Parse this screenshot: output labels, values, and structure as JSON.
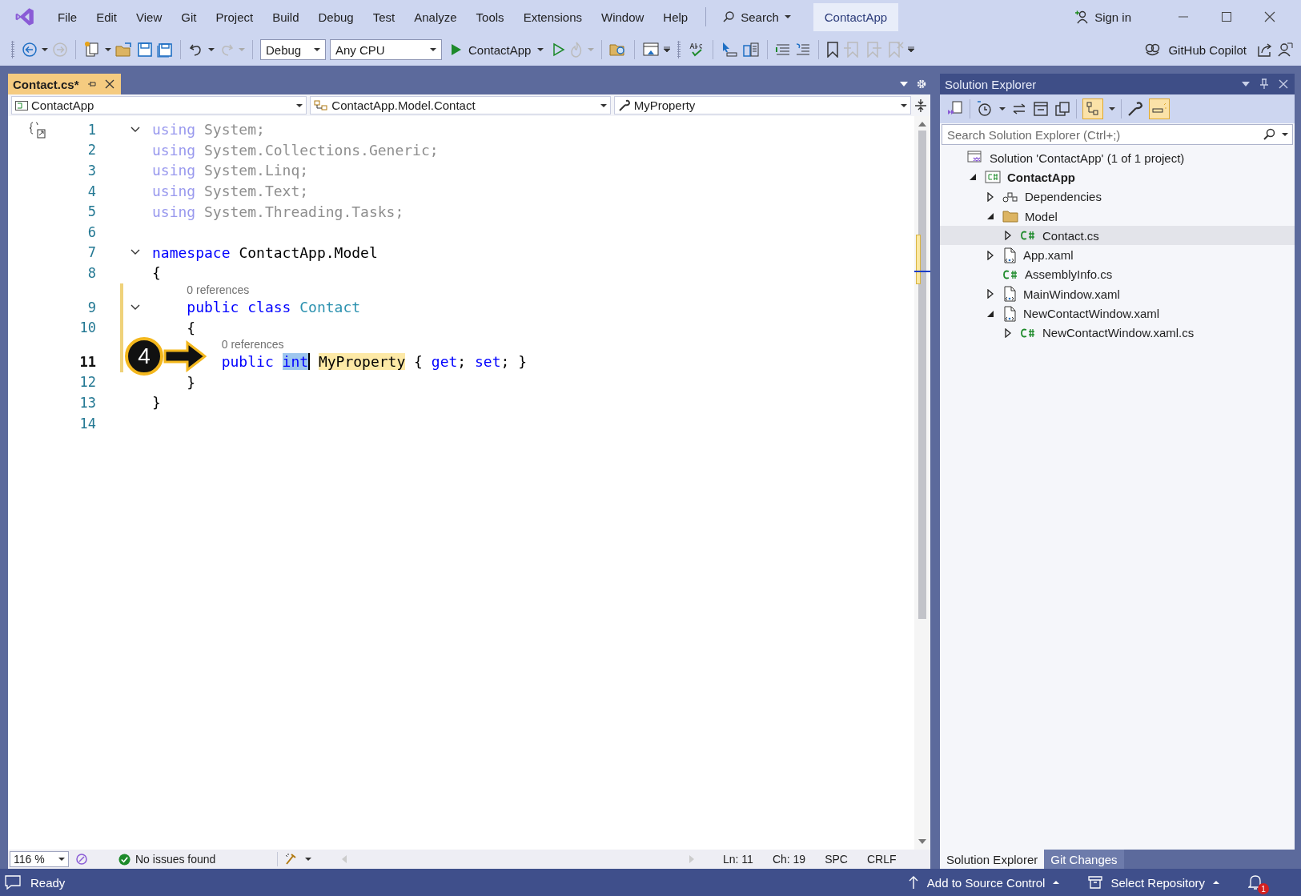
{
  "menu": [
    "File",
    "Edit",
    "View",
    "Git",
    "Project",
    "Build",
    "Debug",
    "Test",
    "Analyze",
    "Tools",
    "Extensions",
    "Window",
    "Help"
  ],
  "title_search": "Search",
  "solution_name": "ContactApp",
  "sign_in": "Sign in",
  "toolbar": {
    "configuration": "Debug",
    "platform": "Any CPU",
    "start": "ContactApp",
    "copilot": "GitHub Copilot"
  },
  "editor": {
    "tab": {
      "label": "Contact.cs*",
      "selected": true
    },
    "nav": [
      "ContactApp",
      "ContactApp.Model.Contact",
      "MyProperty"
    ],
    "lines": [
      {
        "number": "1",
        "expanded": true,
        "modified": false,
        "current": false,
        "tokens": [
          {
            "kind": "faded-keyword",
            "text": "using"
          },
          {
            "kind": "faded",
            "text": " System;"
          }
        ]
      },
      {
        "number": "2",
        "modified": false,
        "current": false,
        "tokens": [
          {
            "kind": "faded-keyword",
            "text": "using"
          },
          {
            "kind": "faded",
            "text": " System.Collections.Generic;"
          }
        ]
      },
      {
        "number": "3",
        "modified": false,
        "current": false,
        "tokens": [
          {
            "kind": "faded-keyword",
            "text": "using"
          },
          {
            "kind": "faded",
            "text": " System.Linq;"
          }
        ]
      },
      {
        "number": "4",
        "modified": false,
        "current": false,
        "tokens": [
          {
            "kind": "faded-keyword",
            "text": "using"
          },
          {
            "kind": "faded",
            "text": " System.Text;"
          }
        ]
      },
      {
        "number": "5",
        "modified": false,
        "current": false,
        "tokens": [
          {
            "kind": "faded-keyword",
            "text": "using"
          },
          {
            "kind": "faded",
            "text": " System.Threading.Tasks;"
          }
        ]
      },
      {
        "number": "6",
        "modified": false,
        "current": false
      },
      {
        "number": "7",
        "expanded": true,
        "modified": false,
        "current": false,
        "tokens": [
          {
            "kind": "keyword",
            "text": "namespace"
          },
          {
            "kind": "plain",
            "text": " ContactApp.Model"
          }
        ]
      },
      {
        "number": "8",
        "modified": false,
        "current": false,
        "tokens": [
          {
            "kind": "plain",
            "text": "{"
          }
        ]
      },
      {
        "number": "9",
        "lens": "0 references",
        "expanded": true,
        "modified": true,
        "current": false,
        "tokens": [
          {
            "kind": "keyword",
            "text": "    public class"
          },
          {
            "kind": "type",
            "text": " Contact"
          }
        ]
      },
      {
        "number": "10",
        "modified": true,
        "current": false,
        "tokens": [
          {
            "kind": "plain",
            "text": "    {"
          }
        ]
      },
      {
        "number": "11",
        "lens": "0 references",
        "modified": true,
        "current": true,
        "tokens": [
          {
            "kind": "keyword",
            "text": "        public "
          },
          {
            "kind": "selected-keyword",
            "text": "int"
          },
          {
            "kind": "reference",
            "text": "MyProperty"
          },
          {
            "kind": "plain",
            "text": " { "
          },
          {
            "kind": "keyword",
            "text": "get"
          },
          {
            "kind": "plain",
            "text": "; "
          },
          {
            "kind": "keyword",
            "text": "set"
          },
          {
            "kind": "plain",
            "text": "; }"
          }
        ]
      },
      {
        "number": "12",
        "modified": false,
        "current": false,
        "tokens": [
          {
            "kind": "plain",
            "text": "    }"
          }
        ]
      },
      {
        "number": "13",
        "modified": false,
        "current": false,
        "tokens": [
          {
            "kind": "plain",
            "text": "}"
          }
        ]
      },
      {
        "number": "14",
        "modified": false,
        "current": false
      }
    ],
    "callout": "4",
    "zoom": "116 %",
    "issues": "No issues found",
    "position": [
      "Ln: 11",
      "Ch: 19",
      "SPC",
      "CRLF"
    ]
  },
  "solution_explorer": {
    "title": "Solution Explorer",
    "search": {
      "placeholder": "Search Solution Explorer (Ctrl+;)"
    },
    "tree": [
      {
        "label": "Solution 'ContactApp' (1 of 1 project)",
        "kind": "solution",
        "selected": false,
        "children": [
          {
            "label": "ContactApp",
            "kind": "project",
            "expanded": true,
            "selected": false,
            "children": [
              {
                "label": "Dependencies",
                "kind": "dependencies",
                "expanded": false,
                "selected": false
              },
              {
                "label": "Model",
                "kind": "folder",
                "expanded": true,
                "selected": false,
                "children": [
                  {
                    "label": "Contact.cs",
                    "kind": "csharp",
                    "expanded": false,
                    "selected": true
                  }
                ]
              },
              {
                "label": "App.xaml",
                "kind": "xaml",
                "expanded": false,
                "selected": false
              },
              {
                "label": "AssemblyInfo.cs",
                "kind": "csharp",
                "selected": false
              },
              {
                "label": "MainWindow.xaml",
                "kind": "xaml",
                "expanded": false,
                "selected": false
              },
              {
                "label": "NewContactWindow.xaml",
                "kind": "xaml",
                "expanded": true,
                "selected": false,
                "children": [
                  {
                    "label": "NewContactWindow.xaml.cs",
                    "kind": "csharp",
                    "expanded": false,
                    "selected": false
                  }
                ]
              }
            ]
          }
        ]
      }
    ],
    "tabs": [
      {
        "label": "Solution Explorer",
        "selected": true
      },
      {
        "label": "Git Changes",
        "selected": false
      }
    ]
  },
  "status_bar": {
    "state": "Ready",
    "source_control": "Add to Source Control",
    "repository": "Select Repository",
    "notifications": "1"
  }
}
